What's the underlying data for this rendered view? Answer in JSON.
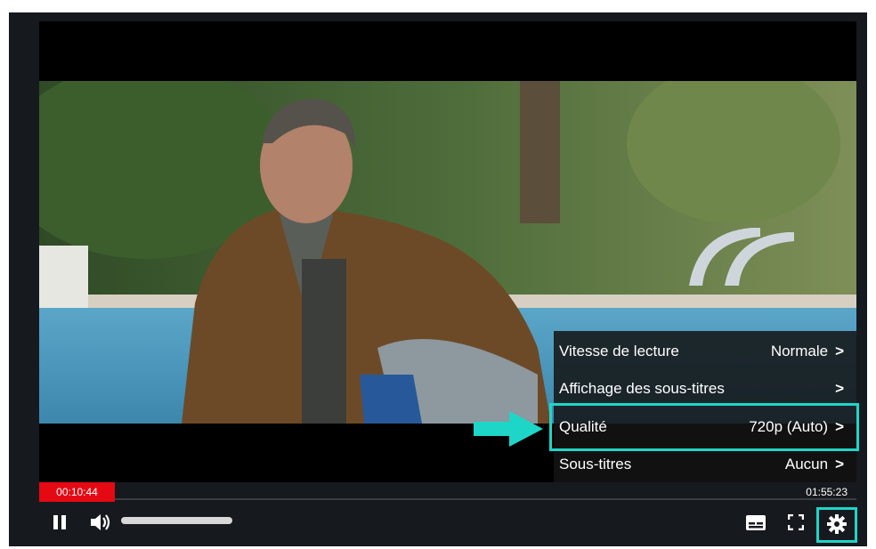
{
  "player": {
    "current_time": "00:10:44",
    "duration": "01:55:23",
    "volume_level": 0.95,
    "played_fraction": 0.093
  },
  "settings_menu": {
    "items": [
      {
        "label": "Vitesse de lecture",
        "value": "Normale",
        "chevron": ">"
      },
      {
        "label": "Affichage des sous-titres",
        "value": "",
        "chevron": ">"
      },
      {
        "label": "Qualité",
        "value": "720p (Auto)",
        "chevron": ">"
      },
      {
        "label": "Sous-titres",
        "value": "Aucun",
        "chevron": ">"
      }
    ],
    "highlighted_item": "Qualité"
  },
  "controls": {
    "icons": [
      "pause-icon",
      "volume-icon",
      "subtitles-icon",
      "fullscreen-icon",
      "gear-icon"
    ]
  },
  "colors": {
    "accent_red": "#e50914",
    "highlight_teal": "#1ed6c8",
    "player_bg": "#161a1f"
  }
}
